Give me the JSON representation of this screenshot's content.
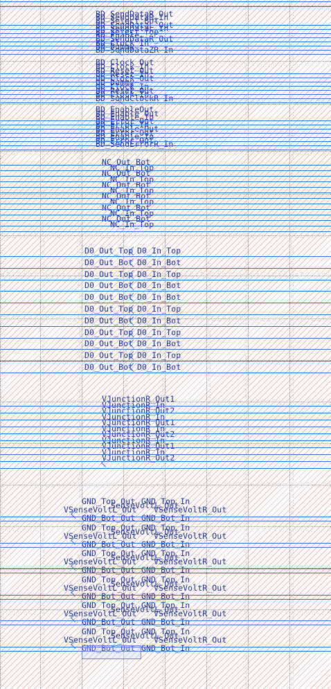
{
  "schematic": {
    "group_senddata": {
      "labels": [
        "BD_SendDataR_Out",
        "BD_SendDataR_In",
        "BD_Select_Bot",
        "BD_SendDataL_Out",
        "BD_SendDataL_In",
        "BD_Select_Top",
        "BD_Enable",
        "BD_SendDataR_Out",
        "BD_Clock_In",
        "BD_Dummy",
        "BD_SendDataZR_In"
      ]
    },
    "group_clock": {
      "labels": [
        "BD_Clock_Out",
        "BD_Clock_In",
        "BD_Reset_Out",
        "BD_Reset_In",
        "BD_Clock_Out",
        "BD_Dummy",
        "BD_Clock_In",
        "BD_Reset_Out",
        "BD_Clock_In",
        "BD_SendClockR_In"
      ]
    },
    "group_enable": {
      "labels": [
        "BD_EnableOut",
        "BD_Enable_Out",
        "BD_Enable_In",
        "BD_Error_Out",
        "BD_Error_In",
        "BD_Enable_Out",
        "BD_Error_Out",
        "BD_Enable_In",
        "BD_Error_Out",
        "BD_SendErrorR_In"
      ]
    },
    "group_nc": {
      "labels": [
        "NC_Out_Bot",
        "NC_In_Top",
        "NC_Out_Bot",
        "NC_In_Top",
        "NC_Out_Bot",
        "NC_In_Top",
        "NC_Out_Bot",
        "NC_In_Top",
        "NC_Out_Bot",
        "NC_In_Top",
        "NC_Out_Bot",
        "NC_In_Top"
      ]
    },
    "group_d0": {
      "rows": [
        {
          "left": "D0_Out_Top",
          "right": "D0_In_Top"
        },
        {
          "left": "D0_Out_Bot",
          "right": "D0_In_Bot"
        },
        {
          "left": "D0_Out_Top",
          "right": "D0_In_Top"
        },
        {
          "left": "D0_Out_Bot",
          "right": "D0_In_Bot"
        },
        {
          "left": "D0_Out_Bot",
          "right": "D0_In_Bot"
        },
        {
          "left": "D0_Out_Top",
          "right": "D0_In_Top"
        },
        {
          "left": "D0_Out_Bot",
          "right": "D0_In_Bot"
        },
        {
          "left": "D0_Out_Top",
          "right": "D0_In_Top"
        },
        {
          "left": "D0_Out_Bot",
          "right": "D0_In_Bot"
        },
        {
          "left": "D0_Out_Top",
          "right": "D0_In_Top"
        },
        {
          "left": "D0_Out_Bot",
          "right": "D0_In_Bot"
        }
      ]
    },
    "group_junction": {
      "labels": [
        "VJunctionR_Out1",
        "VJunctionR_In",
        "VJunctionR_Out2",
        "VJunctionR_In",
        "VJunctionR_Out1",
        "VJunctionR_In",
        "VJunctionR_Out2",
        "VJunctionR_In",
        "VJunctionR_Out1",
        "VJunctionR_In",
        "VJunctionR_Out2"
      ]
    },
    "group_gnd": {
      "block": {
        "top_left": "GND_Top_Out",
        "top_right": "GND_Top_In",
        "mid_left": "VSenseVoltL_Out",
        "mid_right": "VSenseVoltR_Out",
        "mid_center": "SenseVoltL_Out",
        "bot_left": "GND_Bot_Out",
        "bot_right": "GND_Bot_In"
      },
      "repeat": 6
    }
  }
}
